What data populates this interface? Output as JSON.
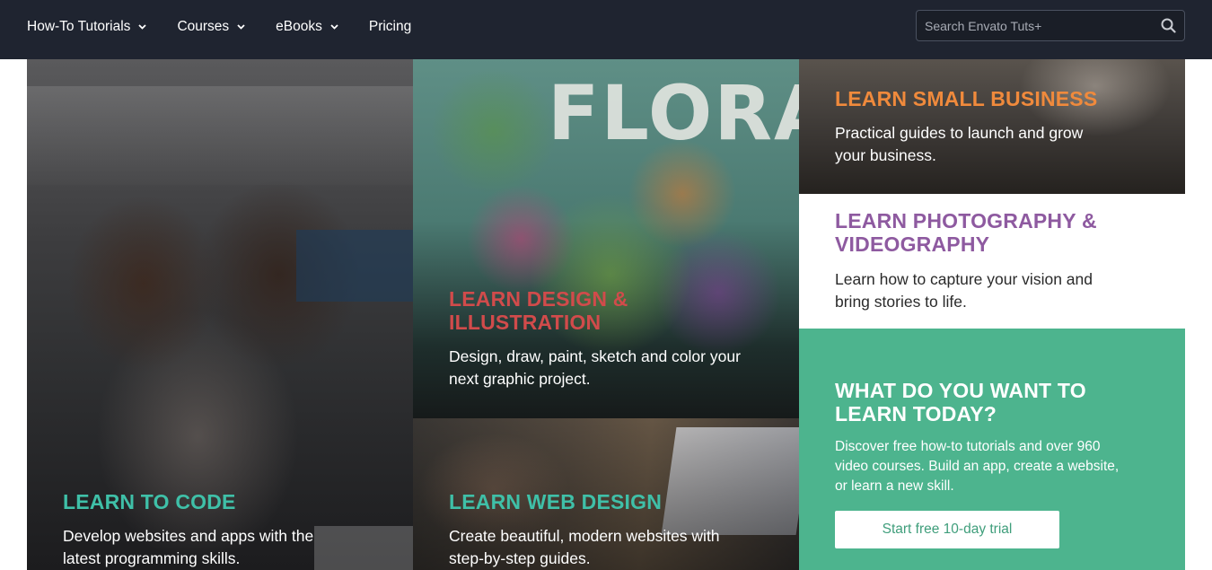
{
  "nav": {
    "items": [
      {
        "label": "How-To Tutorials",
        "has_dropdown": true
      },
      {
        "label": "Courses",
        "has_dropdown": true
      },
      {
        "label": "eBooks",
        "has_dropdown": true
      },
      {
        "label": "Pricing",
        "has_dropdown": false
      }
    ],
    "search": {
      "placeholder": "Search Envato Tuts+",
      "icon": "search-icon"
    }
  },
  "tiles": {
    "code": {
      "title": "LEARN TO CODE",
      "description": "Develop websites and apps with the latest programming skills.",
      "title_color": "#3fc0a8"
    },
    "design": {
      "title": "LEARN DESIGN & ILLUSTRATION",
      "description": "Design, draw, paint, sketch and color your next graphic project.",
      "title_color": "#d14b4b",
      "artwork_text": "FLORAL"
    },
    "web": {
      "title": "LEARN WEB DESIGN",
      "description": "Create beautiful, modern websites with step-by-step guides.",
      "title_color": "#3fc0a8"
    },
    "business": {
      "title": "LEARN SMALL BUSINESS",
      "description": "Practical guides to launch and grow your business.",
      "title_color": "#f08a3c"
    },
    "photo": {
      "title": "LEARN PHOTOGRAPHY & VIDEOGRAPHY",
      "description": "Learn how to capture your vision and bring stories to life.",
      "title_color": "#8e5aa0"
    }
  },
  "cta": {
    "title": "WHAT DO YOU WANT TO LEARN TODAY?",
    "description": "Discover free how-to tutorials and over 960 video courses. Build an app, create a website, or learn a new skill.",
    "button_label": "Start free 10-day trial",
    "background": "#4db48e"
  },
  "colors": {
    "header_bg": "#1f2430"
  }
}
